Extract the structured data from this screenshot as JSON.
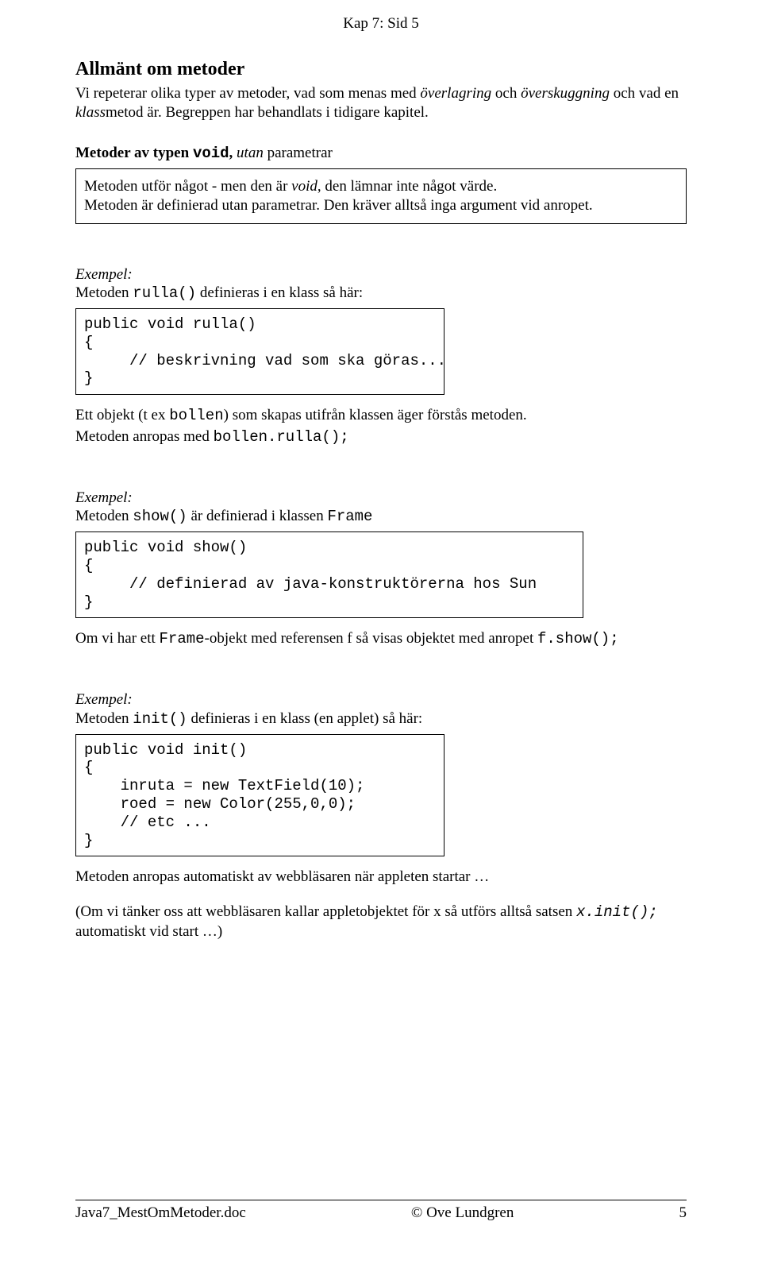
{
  "header": "Kap 7:  Sid  5",
  "h1": "Allmänt om metoder",
  "intro": {
    "p1_a": "Vi repeterar olika typer av metoder, vad som menas med ",
    "p1_b": "överlagring",
    "p1_c": " och ",
    "p1_d": "överskuggning",
    "p1_e": " och vad en ",
    "p1_f": "klass",
    "p1_g": "metod är. Begreppen har behandlats i tidigare kapitel."
  },
  "sec1": {
    "h_a": "Metoder av typen ",
    "h_b": "void",
    "h_c": ",   ",
    "h_d": "utan",
    "h_e": " parametrar",
    "note_a": "Metoden utför något - men den  är ",
    "note_b": "void",
    "note_c": ", den lämnar inte något värde.",
    "note_d": "Metoden är definierad utan parametrar. Den kräver alltså inga argument vid anropet."
  },
  "ex1": {
    "label": "Exempel:",
    "intro_a": "Metoden ",
    "intro_b": "rulla()",
    "intro_c": "  definieras i en klass  så här:",
    "code": "public void rulla()\n{\n     // beskrivning vad som ska göras...\n}",
    "after_a": "Ett objekt (t ex ",
    "after_b": "bollen",
    "after_c": ") som skapas utifrån klassen äger förstås metoden.",
    "after_d": "Metoden anropas med ",
    "after_e": "bollen.rulla();"
  },
  "ex2": {
    "label": "Exempel:",
    "intro_a": "Metoden ",
    "intro_b": "show()",
    "intro_c": " är definierad i klassen ",
    "intro_d": "Frame",
    "code": "public void show()\n{\n     // definierad av java-konstruktörerna hos Sun\n}",
    "after_a": "Om vi har ett ",
    "after_b": "Frame",
    "after_c": "-objekt med referensen  f  så visas objektet med anropet   ",
    "after_d": "f.show();"
  },
  "ex3": {
    "label": "Exempel:",
    "intro_a": "Metoden  ",
    "intro_b": "init()",
    "intro_c": "  definieras i en klass (en applet)  så här:",
    "code": "public void init()\n{\n    inruta = new TextField(10);\n    roed = new Color(255,0,0);\n    // etc ...\n}",
    "after_a": "Metoden anropas automatiskt av webbläsaren när appleten startar …",
    "after_b": " (Om vi tänker oss att webbläsaren kallar appletobjektet för x  så utförs alltså satsen   ",
    "after_c": "x.init();",
    "after_d": "  automatiskt vid start …)"
  },
  "footer": {
    "left": "Java7_MestOmMetoder.doc",
    "center": "© Ove Lundgren",
    "right": "5"
  }
}
